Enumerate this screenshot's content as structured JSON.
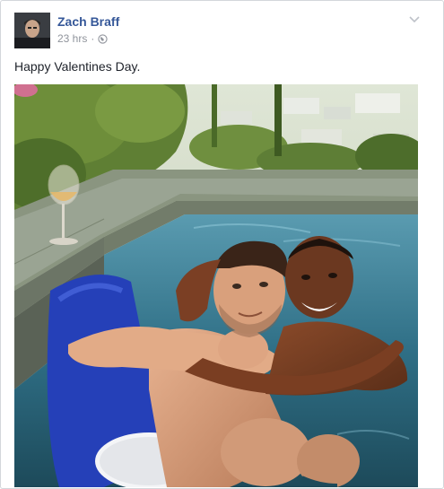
{
  "post": {
    "author_name": "Zach Braff",
    "timestamp": "23 hrs",
    "separator": "·",
    "audience_icon": "globe-icon",
    "options_icon": "chevron-down-icon",
    "message": "Happy Valentines Day."
  },
  "colors": {
    "author_link": "#365899",
    "meta_text": "#90949c",
    "body_text": "#1d2129",
    "border": "#d3d6db"
  }
}
